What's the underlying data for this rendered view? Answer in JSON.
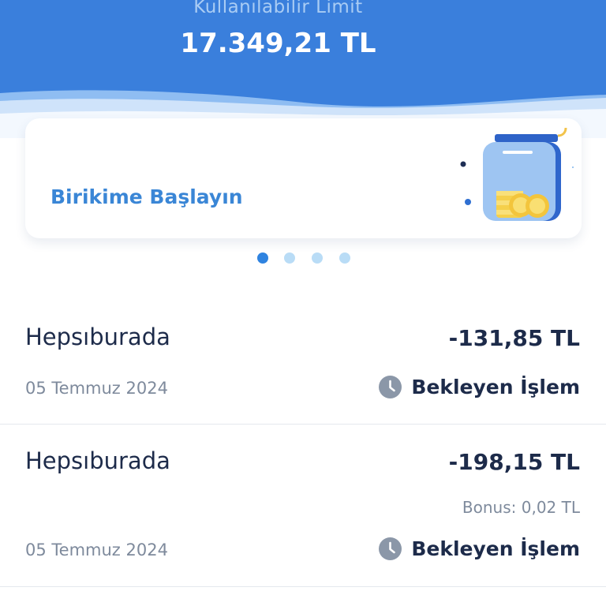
{
  "header": {
    "limit_label": "Kullanılabilir Limit",
    "limit_value": "17.349,21 TL",
    "color": "#3a7fdc"
  },
  "promo": {
    "title": "Birikime Başlayın",
    "icon": "savings-jar-icon",
    "carousel_total": 4,
    "carousel_active": 1
  },
  "transactions": [
    {
      "merchant": "Hepsıburada",
      "amount": "-131,85 TL",
      "date": "05 Temmuz 2024",
      "status": "Bekleyen İşlem",
      "status_icon": "clock-icon"
    },
    {
      "merchant": "Hepsıburada",
      "amount": "-198,15 TL",
      "bonus": "Bonus: 0,02 TL",
      "date": "05 Temmuz 2024",
      "status": "Bekleyen İşlem",
      "status_icon": "clock-icon"
    }
  ]
}
